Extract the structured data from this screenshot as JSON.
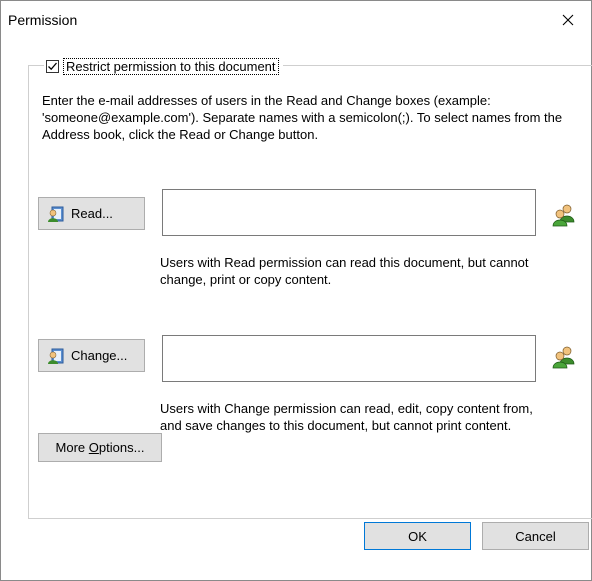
{
  "window": {
    "title": "Permission"
  },
  "restrict": {
    "label": "Restrict permission to this document",
    "checked": true
  },
  "instructions": "Enter the e-mail addresses of users in the Read and Change boxes (example: 'someone@example.com'). Separate names with a semicolon(;). To select names from the Address book, click the Read or Change button.",
  "read": {
    "button_label": "Read...",
    "value": "",
    "description": "Users with Read permission can read this document, but cannot change, print or copy content."
  },
  "change": {
    "button_label": "Change...",
    "value": "",
    "description": "Users with Change permission can read, edit, copy content from, and save changes to this document, but cannot print content."
  },
  "more_options": {
    "label_before": "More ",
    "label_underlined": "O",
    "label_after": "ptions..."
  },
  "footer": {
    "ok_label": "OK",
    "cancel_label": "Cancel"
  },
  "icons": {
    "close": "close-icon",
    "address_book": "address-book-icon",
    "people": "people-icon",
    "check": "checkmark-icon"
  },
  "colors": {
    "button_bg": "#e1e1e1",
    "default_button_border": "#0078d7",
    "icon_green": "#3c8c2c"
  }
}
